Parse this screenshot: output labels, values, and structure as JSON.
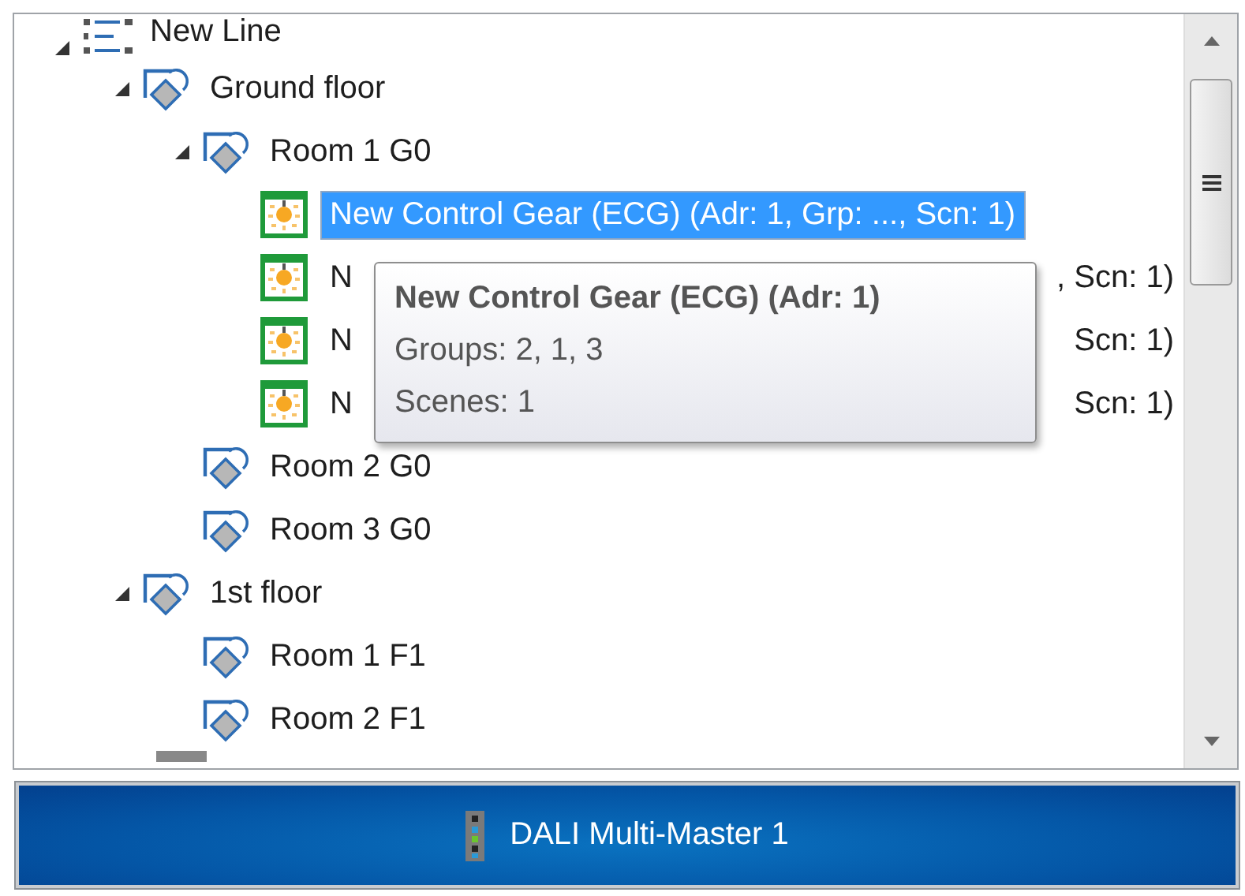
{
  "tree": {
    "nodes": [
      {
        "kind": "line",
        "label": "New Line",
        "expanded": true,
        "selected": false,
        "children": [
          {
            "kind": "area",
            "label": "Ground floor",
            "expanded": true,
            "selected": false,
            "children": [
              {
                "kind": "area",
                "label": "Room 1 G0",
                "expanded": true,
                "selected": false,
                "children": [
                  {
                    "kind": "gear",
                    "label": "New Control Gear (ECG) (Adr: 1, Grp: ..., Scn: 1)",
                    "selected": true
                  },
                  {
                    "kind": "gear",
                    "label_start": "N",
                    "label_end": ", Scn: 1)",
                    "selected": false
                  },
                  {
                    "kind": "gear",
                    "label_start": "N",
                    "label_end": "Scn: 1)",
                    "selected": false
                  },
                  {
                    "kind": "gear",
                    "label_start": "N",
                    "label_end": "Scn: 1)",
                    "selected": false
                  }
                ]
              },
              {
                "kind": "area",
                "label": "Room 2 G0",
                "selected": false
              },
              {
                "kind": "area",
                "label": "Room 3 G0",
                "selected": false
              }
            ]
          },
          {
            "kind": "area",
            "label": "1st floor",
            "expanded": true,
            "selected": false,
            "children": [
              {
                "kind": "area",
                "label": "Room 1 F1",
                "selected": false
              },
              {
                "kind": "area",
                "label": "Room 2 F1",
                "selected": false
              }
            ]
          }
        ]
      }
    ]
  },
  "tooltip": {
    "title": "New Control Gear (ECG) (Adr: 1)",
    "lines": [
      "Groups: 2, 1, 3",
      "Scenes: 1"
    ]
  },
  "master_bar": {
    "label": "DALI Multi-Master 1"
  }
}
